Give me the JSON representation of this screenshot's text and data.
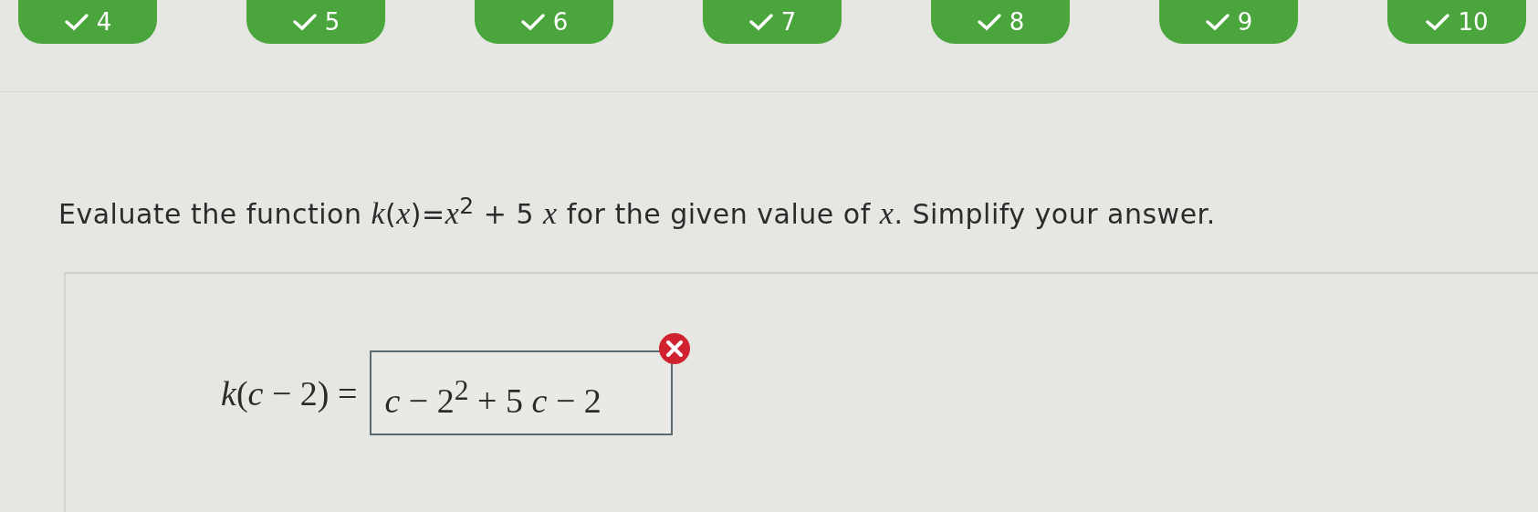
{
  "steps": [
    {
      "label": "4",
      "done": true
    },
    {
      "label": "5",
      "done": true
    },
    {
      "label": "6",
      "done": true
    },
    {
      "label": "7",
      "done": true
    },
    {
      "label": "8",
      "done": true
    },
    {
      "label": "9",
      "done": true
    },
    {
      "label": "10",
      "done": true
    }
  ],
  "question": "Evaluate the function *k*(*x*)=*x*$^{2}$ + 5 *x* for the given value of *x*. Simplify your answer.",
  "answer": {
    "prompt": "*k*(*c* − 2) =",
    "value": "*c* − 2$^{2}$ + 5 *c* − 2",
    "incorrect": true
  }
}
